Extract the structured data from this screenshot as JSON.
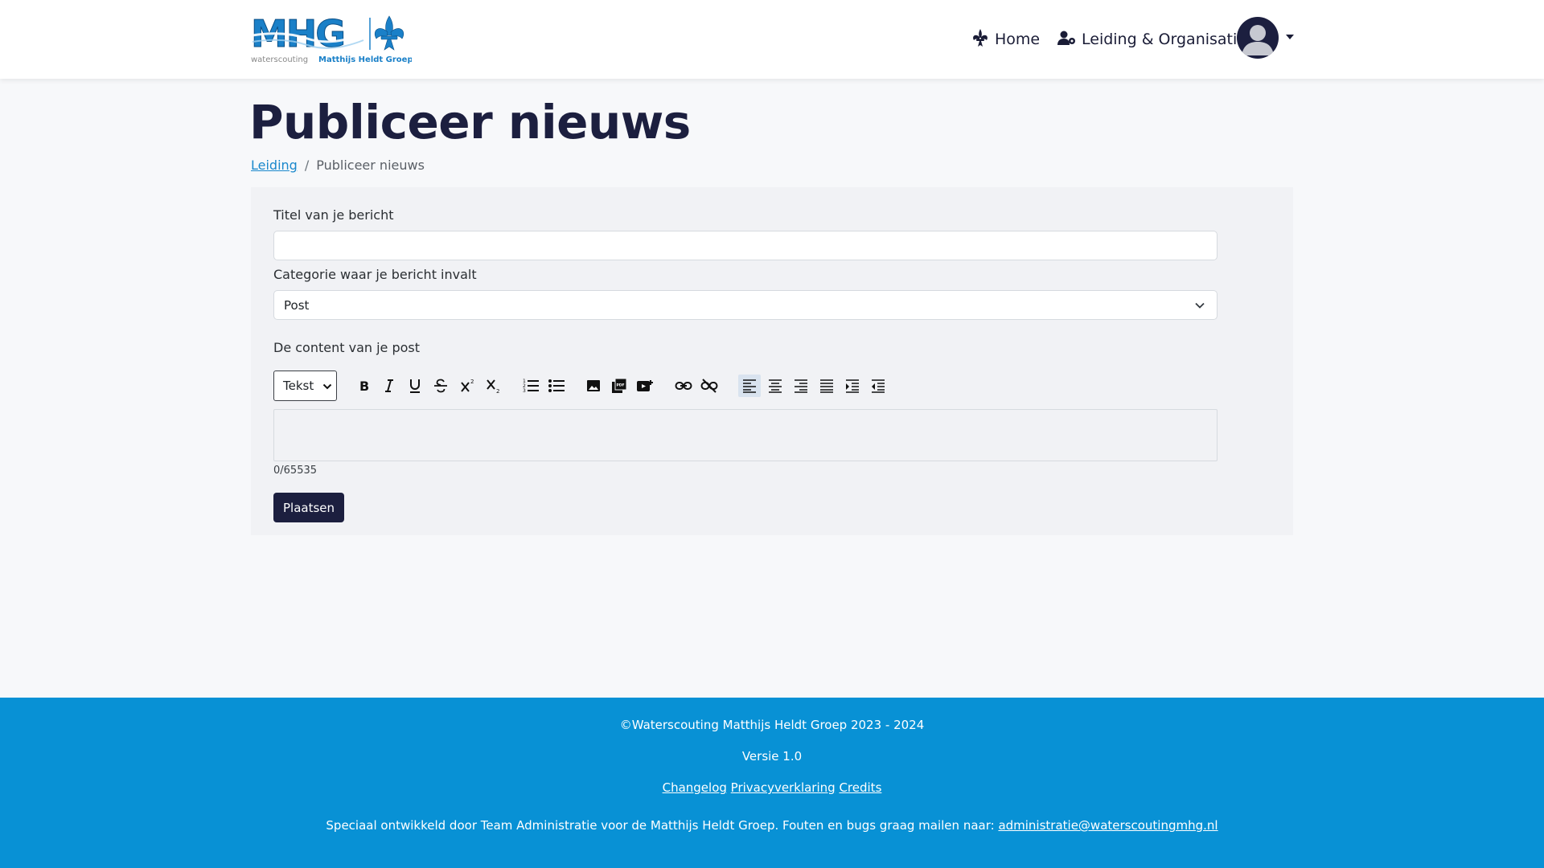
{
  "nav": {
    "logo_text": "MHG",
    "logo_subtext_1": "waterscouting",
    "logo_subtext_2": "Matthijs Heldt Groep",
    "home_label": "Home",
    "leiding_label": "Leiding & Organisatie"
  },
  "page": {
    "title": "Publiceer nieuws",
    "breadcrumb": [
      {
        "label": "Leiding"
      },
      {
        "label": "Publiceer nieuws"
      }
    ]
  },
  "form": {
    "title_label": "Titel van je bericht",
    "title_value": "",
    "category_label": "Categorie waar je bericht invalt",
    "category_value": "Post",
    "content_label": "De content van je post",
    "format_select_value": "Tekst",
    "toolbar_icons": [
      "bold-icon",
      "italic-icon",
      "underline-icon",
      "strikethrough-icon",
      "superscript-icon",
      "subscript-icon",
      "ordered-list-icon",
      "unordered-list-icon",
      "image-icon",
      "pdf-icon",
      "video-icon",
      "link-icon",
      "unlink-icon",
      "align-left-icon",
      "align-center-icon",
      "align-right-icon",
      "align-justify-icon",
      "indent-icon",
      "outdent-icon"
    ],
    "counter": "0/65535",
    "submit_label": "Plaatsen"
  },
  "footer": {
    "copyright": "©Waterscouting Matthijs Heldt Groep 2023 - 2024",
    "version": "Versie 1.0",
    "links": [
      "Changelog",
      "Privacyverklaring",
      "Credits"
    ],
    "note": "Speciaal ontwikkeld door Team Administratie voor de Matthijs Heldt Groep. Fouten en bugs graag mailen naar: ",
    "email": "administratie@waterscoutingmhg.nl"
  },
  "colors": {
    "primary": "#1c1f3f",
    "footer_bg": "#0891d5",
    "link": "#1a88cc",
    "logo_blue": "#1a80c8"
  }
}
